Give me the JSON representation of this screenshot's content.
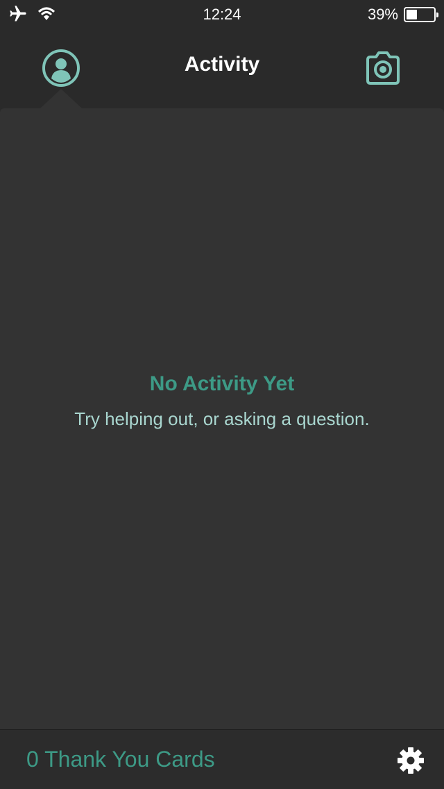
{
  "status_bar": {
    "time": "12:24",
    "battery_text": "39%",
    "battery_level": 0.39,
    "airplane_icon": "airplane-icon",
    "wifi_icon": "wifi-icon"
  },
  "nav": {
    "title": "Activity",
    "left_icon": "profile-icon",
    "right_icon": "camera-icon"
  },
  "empty_state": {
    "title": "No Activity Yet",
    "subtitle": "Try helping out, or asking a question."
  },
  "footer": {
    "thank_you_label": "0 Thank You Cards",
    "settings_icon": "gear-icon"
  },
  "colors": {
    "accent": "#3d9a86",
    "accent_light": "#a9d6cf",
    "icon_teal": "#7fc4b8",
    "background": "#2a2a2a",
    "panel": "#333333"
  }
}
